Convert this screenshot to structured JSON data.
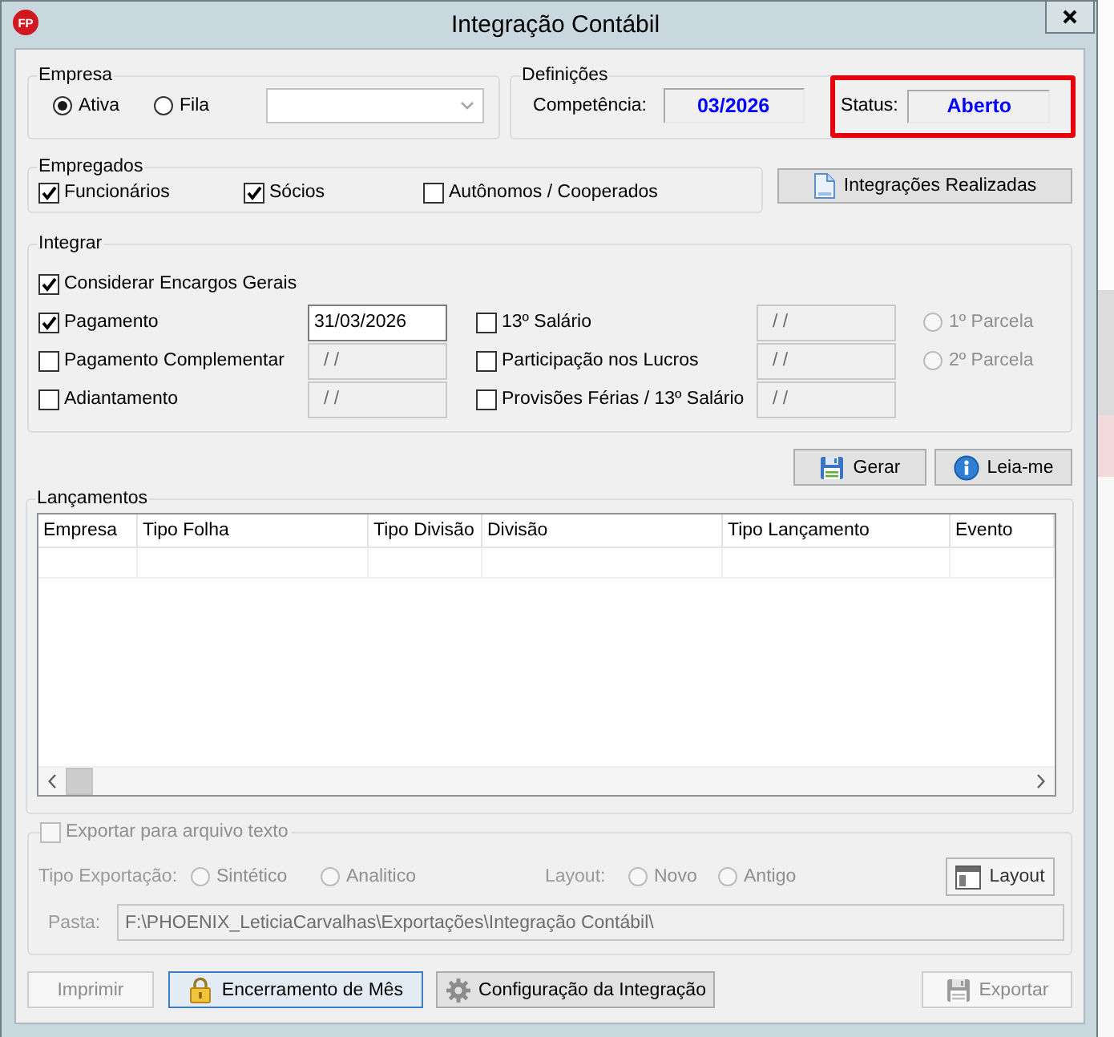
{
  "window": {
    "title": "Integração Contábil",
    "logo_text": "FP"
  },
  "empresa": {
    "title": "Empresa",
    "options": [
      {
        "label": "Ativa",
        "selected": true
      },
      {
        "label": "Fila",
        "selected": false
      }
    ]
  },
  "definicoes": {
    "title": "Definições",
    "competencia": {
      "label": "Competência:",
      "value": "03/2026"
    },
    "status": {
      "label": "Status:",
      "value": "Aberto",
      "highlighted": true
    }
  },
  "empregados": {
    "title": "Empregados",
    "options": [
      {
        "label": "Funcionários",
        "checked": true
      },
      {
        "label": "Sócios",
        "checked": true
      },
      {
        "label": "Autônomos / Cooperados",
        "checked": false
      }
    ]
  },
  "integracoes_button": {
    "label": "Integrações Realizadas"
  },
  "integrar": {
    "title": "Integrar",
    "encargos": {
      "label": "Considerar Encargos Gerais",
      "checked": true
    },
    "left": [
      {
        "label": "Pagamento",
        "checked": true,
        "date": "31/03/2026",
        "date_disabled": false
      },
      {
        "label": "Pagamento Complementar",
        "checked": false,
        "date": "/ /",
        "date_disabled": true
      },
      {
        "label": "Adiantamento",
        "checked": false,
        "date": "/ /",
        "date_disabled": true
      }
    ],
    "right": [
      {
        "label": "13º Salário",
        "checked": false,
        "date": "/ /",
        "date_disabled": true
      },
      {
        "label": "Participação nos Lucros",
        "checked": false,
        "date": "/ /",
        "date_disabled": true
      },
      {
        "label": "Provisões Férias / 13º Salário",
        "checked": false,
        "date": "/ /",
        "date_disabled": true
      }
    ],
    "parcelas": [
      {
        "label": "1º Parcela",
        "selected": false,
        "disabled": true
      },
      {
        "label": "2º Parcela",
        "selected": false,
        "disabled": true
      }
    ]
  },
  "generate_button": {
    "label": "Gerar"
  },
  "readme_button": {
    "label": "Leia-me"
  },
  "lancamentos": {
    "title": "Lançamentos",
    "columns": [
      "Empresa",
      "Tipo Folha",
      "Tipo Divisão",
      "Divisão",
      "Tipo Lançamento",
      "Evento"
    ]
  },
  "exportacao": {
    "title": "Exportar para arquivo texto",
    "checked": false,
    "disabled": true,
    "type_label": "Tipo Exportação:",
    "type_options": [
      {
        "label": "Sintético",
        "selected": false
      },
      {
        "label": "Analitico",
        "selected": false
      }
    ],
    "layout_label": "Layout:",
    "layout_options": [
      {
        "label": "Novo",
        "selected": false
      },
      {
        "label": "Antigo",
        "selected": false
      }
    ],
    "layout_button": {
      "label": "Layout"
    },
    "folder_label": "Pasta:",
    "folder": "F:\\PHOENIX_LeticiaCarvalhas\\Exportações\\Integração Contábil\\"
  },
  "footer": {
    "print": {
      "label": "Imprimir",
      "disabled": true,
      "focused": false
    },
    "close_month": {
      "label": "Encerramento de Mês",
      "disabled": false,
      "focused": true
    },
    "settings": {
      "label": "Configuração da Integração",
      "disabled": false,
      "focused": false
    },
    "export": {
      "label": "Exportar",
      "disabled": true,
      "focused": false
    }
  }
}
